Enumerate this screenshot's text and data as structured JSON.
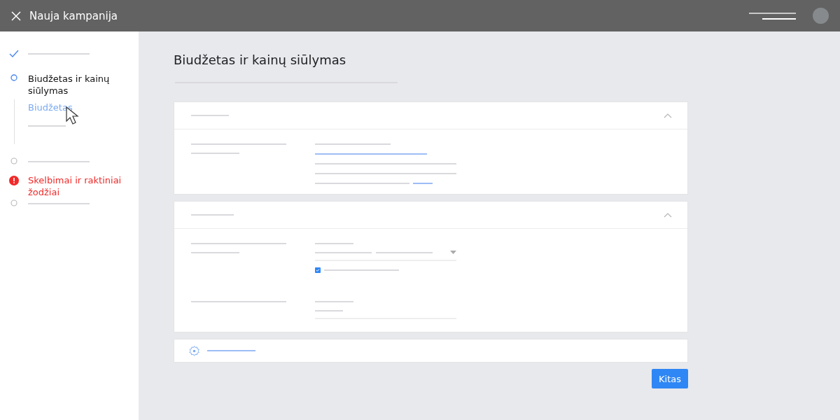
{
  "header": {
    "title": "Nauja kampanija"
  },
  "steps": [
    {
      "kind": "done"
    },
    {
      "kind": "current",
      "label": "Biudžetas ir kainų siūlymas",
      "substeps": [
        {
          "kind": "link",
          "label": "Biudžetas",
          "selected": true
        },
        {
          "kind": "line"
        }
      ]
    },
    {
      "kind": "pending"
    },
    {
      "kind": "error",
      "label": "Skelbimai ir raktiniai žodžiai"
    },
    {
      "kind": "pending"
    }
  ],
  "page": {
    "title": "Biudžetas ir kainų siūlymas"
  },
  "sections": [
    {
      "expanded": true
    },
    {
      "expanded": true,
      "checkbox": {
        "checked": true
      }
    }
  ],
  "next_button": "Kitas"
}
